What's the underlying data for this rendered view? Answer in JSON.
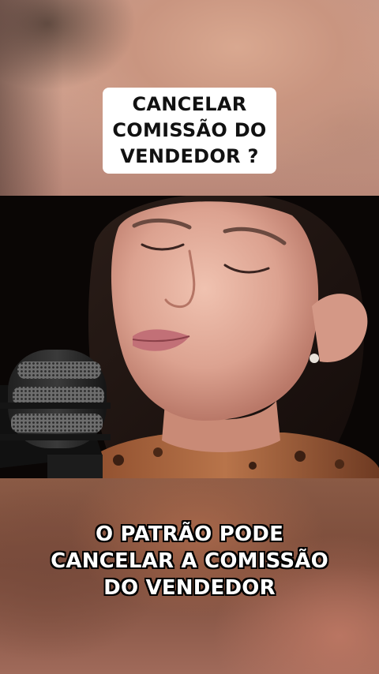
{
  "title_card": {
    "text": "CANCELAR\nCOMISSÃO DO\nVENDEDOR ?"
  },
  "video": {
    "subject": "woman-speaking-into-microphone"
  },
  "caption": {
    "text": "O PATRÃO PODE\nCANCELAR A COMISSÃO\nDO VENDEDOR"
  },
  "colors": {
    "title_background": "#ffffff",
    "title_text": "#111111",
    "caption_text": "#ffffff",
    "caption_outline": "#000000"
  }
}
